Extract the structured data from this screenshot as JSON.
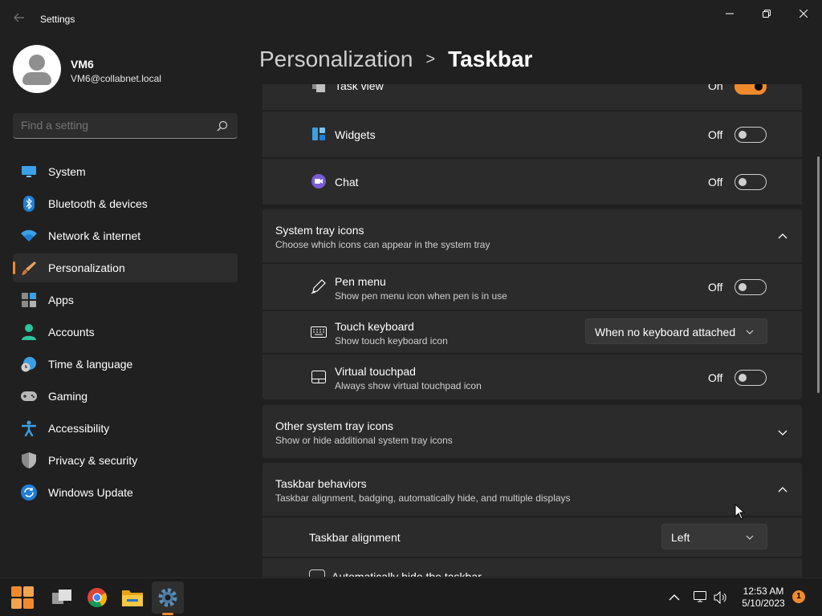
{
  "window": {
    "title": "Settings",
    "back_icon": "arrow-left-icon",
    "controls": [
      "minimize-icon",
      "restore-icon",
      "close-icon"
    ]
  },
  "profile": {
    "name": "VM6",
    "email": "VM6@collabnet.local"
  },
  "search": {
    "placeholder": "Find a setting",
    "icon": "search-icon"
  },
  "nav": {
    "items": [
      {
        "label": "System",
        "icon": "monitor-icon",
        "active": false
      },
      {
        "label": "Bluetooth & devices",
        "icon": "bluetooth-icon",
        "active": false
      },
      {
        "label": "Network & internet",
        "icon": "wifi-icon",
        "active": false
      },
      {
        "label": "Personalization",
        "icon": "brush-icon",
        "active": true
      },
      {
        "label": "Apps",
        "icon": "apps-icon",
        "active": false
      },
      {
        "label": "Accounts",
        "icon": "person-icon",
        "active": false
      },
      {
        "label": "Time & language",
        "icon": "globe-clock-icon",
        "active": false
      },
      {
        "label": "Gaming",
        "icon": "gamepad-icon",
        "active": false
      },
      {
        "label": "Accessibility",
        "icon": "accessibility-icon",
        "active": false
      },
      {
        "label": "Privacy & security",
        "icon": "shield-icon",
        "active": false
      },
      {
        "label": "Windows Update",
        "icon": "update-icon",
        "active": false
      }
    ]
  },
  "breadcrumb": {
    "parent": "Personalization",
    "separator": ">",
    "current": "Taskbar"
  },
  "taskbar_items": {
    "task_view": {
      "label": "Task view",
      "state": "On",
      "on": true
    },
    "widgets": {
      "label": "Widgets",
      "state": "Off",
      "on": false
    },
    "chat": {
      "label": "Chat",
      "state": "Off",
      "on": false
    }
  },
  "system_tray": {
    "title": "System tray icons",
    "subtitle": "Choose which icons can appear in the system tray",
    "expanded": true,
    "pen_menu": {
      "title": "Pen menu",
      "subtitle": "Show pen menu icon when pen is in use",
      "state": "Off"
    },
    "touch_keyboard": {
      "title": "Touch keyboard",
      "subtitle": "Show touch keyboard icon",
      "value": "When no keyboard attached"
    },
    "virtual_touchpad": {
      "title": "Virtual touchpad",
      "subtitle": "Always show virtual touchpad icon",
      "state": "Off"
    }
  },
  "other_tray": {
    "title": "Other system tray icons",
    "subtitle": "Show or hide additional system tray icons",
    "expanded": false
  },
  "behaviors": {
    "title": "Taskbar behaviors",
    "subtitle": "Taskbar alignment, badging, automatically hide, and multiple displays",
    "expanded": true,
    "alignment_label": "Taskbar alignment",
    "alignment_value": "Left",
    "autohide_label": "Automatically hide the taskbar"
  },
  "taskbar": {
    "apps": [
      "start-icon",
      "task-view-icon",
      "chrome-icon",
      "file-explorer-icon",
      "settings-icon"
    ],
    "tray_icons": [
      "chevron-up-icon",
      "network-icon",
      "volume-icon"
    ],
    "time": "12:53 AM",
    "date": "5/10/2023",
    "notification_count": "1"
  },
  "colors": {
    "accent": "#f08a2c",
    "background": "#202020",
    "card": "#2b2b2b"
  }
}
